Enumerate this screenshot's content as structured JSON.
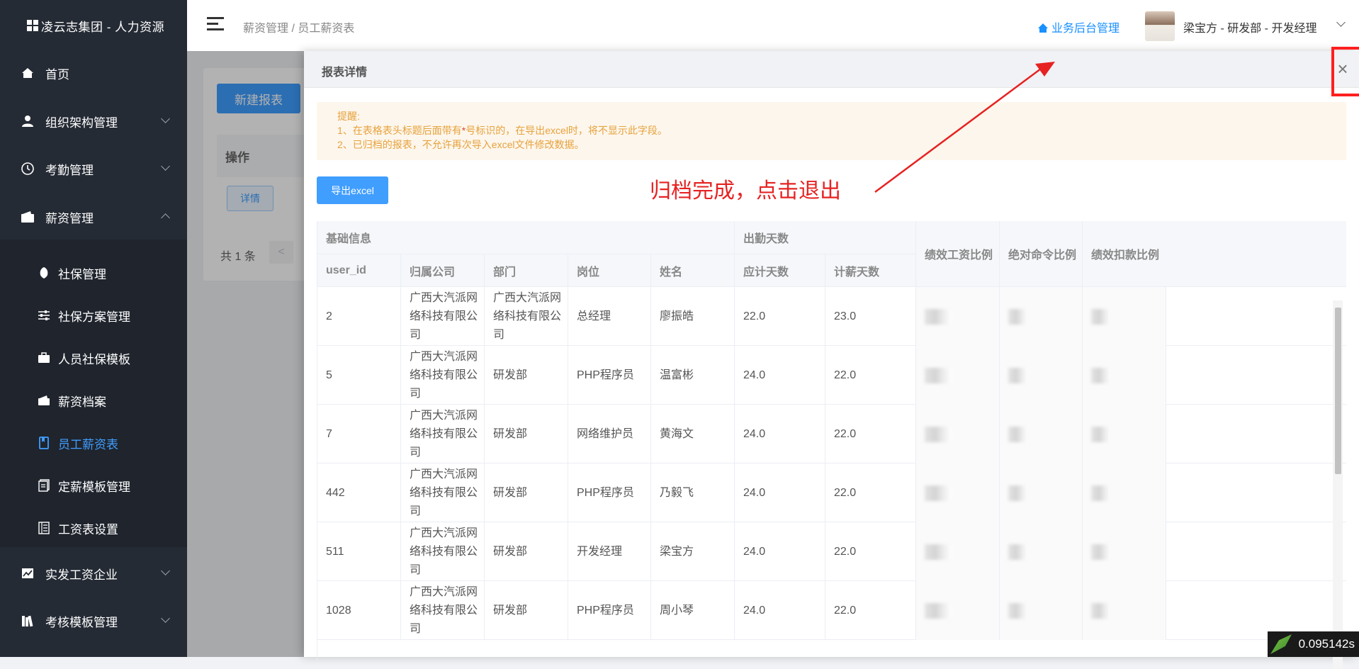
{
  "brand": {
    "title": "凌云志集团 - 人力资源"
  },
  "header": {
    "breadcrumb": "薪资管理 / 员工薪资表",
    "biz_link": "业务后台管理",
    "user": "梁宝方 - 研发部 - 开发经理"
  },
  "sidebar": {
    "items": [
      {
        "label": "首页",
        "icon": "home-icon"
      },
      {
        "label": "组织架构管理",
        "icon": "user-icon"
      },
      {
        "label": "考勤管理",
        "icon": "clock-icon"
      },
      {
        "label": "薪资管理",
        "icon": "wallet-icon"
      }
    ],
    "sub_items": [
      {
        "label": "社保管理",
        "icon": "shield-icon"
      },
      {
        "label": "社保方案管理",
        "icon": "sliders-icon"
      },
      {
        "label": "人员社保模板",
        "icon": "briefcase-icon"
      },
      {
        "label": "薪资档案",
        "icon": "wallet-icon"
      },
      {
        "label": "员工薪资表",
        "icon": "book-icon"
      },
      {
        "label": "定薪模板管理",
        "icon": "template-icon"
      },
      {
        "label": "工资表设置",
        "icon": "list-icon"
      }
    ],
    "bottom_items": [
      {
        "label": "实发工资企业",
        "icon": "chart-icon"
      },
      {
        "label": "考核模板管理",
        "icon": "books-icon"
      }
    ],
    "active": "员工薪资表"
  },
  "background": {
    "new_button": "新建报表",
    "op_header": "操作",
    "detail_btn": "详情",
    "total": "共 1 条",
    "prev": "<"
  },
  "drawer": {
    "title": "报表详情",
    "close": "×",
    "tip_title": "提醒:",
    "tip_line1_a": "1、在表格表头标题后面带有",
    "tip_line1_star": "*",
    "tip_line1_b": "号标识的，在导出excel时，将不显示此字段。",
    "tip_line2": "2、已归档的报表，不允许再次导入excel文件修改数据。",
    "export": "导出excel",
    "annotation": "归档完成，点击退出"
  },
  "table": {
    "group_basic": "基础信息",
    "group_attendance": "出勤天数",
    "headers": [
      "user_id",
      "归属公司",
      "部门",
      "岗位",
      "姓名",
      "应计天数",
      "计薪天数",
      "绩效工资比例",
      "绝对命令比例",
      "绩效扣款比例"
    ],
    "rows": [
      {
        "user_id": "2",
        "company": "广西大汽派网络科技有限公司",
        "dept": "广西大汽派网络科技有限公司",
        "position": "总经理",
        "name": "廖振皓",
        "due_days": "22.0",
        "paid_days": "23.0"
      },
      {
        "user_id": "5",
        "company": "广西大汽派网络科技有限公司",
        "dept": "研发部",
        "position": "PHP程序员",
        "name": "温富彬",
        "due_days": "24.0",
        "paid_days": "22.0"
      },
      {
        "user_id": "7",
        "company": "广西大汽派网络科技有限公司",
        "dept": "研发部",
        "position": "网络维护员",
        "name": "黄海文",
        "due_days": "24.0",
        "paid_days": "22.0"
      },
      {
        "user_id": "442",
        "company": "广西大汽派网络科技有限公司",
        "dept": "研发部",
        "position": "PHP程序员",
        "name": "乃毅飞",
        "due_days": "24.0",
        "paid_days": "22.0"
      },
      {
        "user_id": "511",
        "company": "广西大汽派网络科技有限公司",
        "dept": "研发部",
        "position": "开发经理",
        "name": "梁宝方",
        "due_days": "24.0",
        "paid_days": "22.0"
      },
      {
        "user_id": "1028",
        "company": "广西大汽派网络科技有限公司",
        "dept": "研发部",
        "position": "PHP程序员",
        "name": "周小琴",
        "due_days": "24.0",
        "paid_days": "22.0"
      }
    ]
  },
  "timer": "0.095142s"
}
